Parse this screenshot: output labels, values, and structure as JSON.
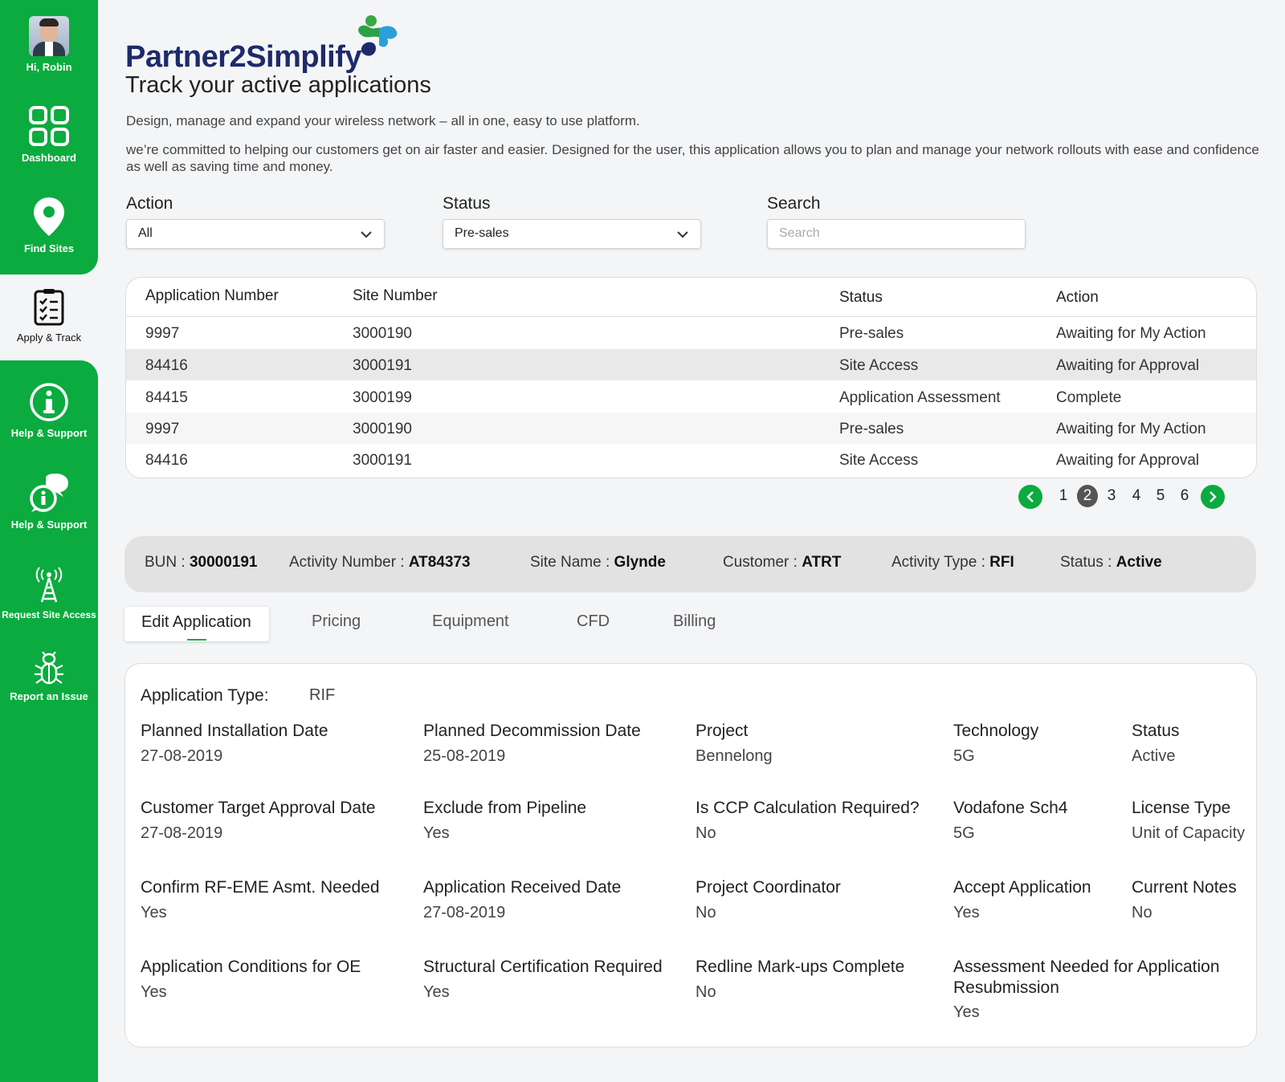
{
  "sidebar": {
    "user_greeting": "Hi, Robin",
    "items": [
      {
        "label": "Dashboard",
        "icon": "grid-icon"
      },
      {
        "label": "Find Sites",
        "icon": "map-pin-icon"
      },
      {
        "label": "Apply & Track",
        "icon": "checklist-icon"
      },
      {
        "label": "Help & Support",
        "icon": "info-icon"
      },
      {
        "label": "Help & Support",
        "icon": "chat-info-icon"
      },
      {
        "label": "Request Site Access",
        "icon": "antenna-tower-icon"
      },
      {
        "label": "Report an Issue",
        "icon": "bug-icon"
      }
    ],
    "active_index": 2
  },
  "header": {
    "logo_text": "Partner2Simplify",
    "title": "Track your active applications",
    "desc1": "Design, manage and expand your wireless network – all in one, easy to use platform.",
    "desc2": "we’re committed to helping our customers get on air faster and easier. Designed for the user, this application allows you to plan and manage  your network rollouts with ease and confidence as well as saving time and money."
  },
  "filters": {
    "action": {
      "label": "Action",
      "value": "All"
    },
    "status": {
      "label": "Status",
      "value": "Pre-sales"
    },
    "search": {
      "label": "Search",
      "placeholder": "Search"
    }
  },
  "table": {
    "columns": [
      "Application Number",
      "Site Number",
      "Status",
      "Action"
    ],
    "rows": [
      [
        "9997",
        "3000190",
        "Pre-sales",
        "Awaiting for My Action"
      ],
      [
        "84416",
        "3000191",
        "Site Access",
        "Awaiting for Approval"
      ],
      [
        "84415",
        "3000199",
        "Application Assessment",
        "Complete"
      ],
      [
        "9997",
        "3000190",
        "Pre-sales",
        "Awaiting for My Action"
      ],
      [
        "84416",
        "3000191",
        "Site Access",
        "Awaiting for Approval"
      ]
    ]
  },
  "pagination": {
    "pages": [
      "1",
      "2",
      "3",
      "4",
      "5",
      "6"
    ],
    "current": "2"
  },
  "info_bar": {
    "bun_label": "BUN :",
    "bun_value": "30000191",
    "activity_label": "Activity Number :",
    "activity_value": "AT84373",
    "site_label": "Site Name :",
    "site_value": "Glynde",
    "customer_label": "Customer :",
    "customer_value": "ATRT",
    "type_label": "Activity Type :",
    "type_value": "RFI",
    "status_label": "Status :",
    "status_value": "Active"
  },
  "tabs": [
    "Edit Application",
    "Pricing",
    "Equipment",
    "CFD",
    "Billing"
  ],
  "details": {
    "app_type_label": "Application Type:",
    "app_type_value": "RIF",
    "fields": [
      {
        "label": "Planned Installation Date",
        "value": "27-08-2019"
      },
      {
        "label": "Planned Decommission Date",
        "value": "25-08-2019"
      },
      {
        "label": "Project",
        "value": "Bennelong"
      },
      {
        "label": "Technology",
        "value": "5G"
      },
      {
        "label": "Status",
        "value": "Active"
      },
      {
        "label": "Customer Target Approval Date",
        "value": "27-08-2019"
      },
      {
        "label": "Exclude from Pipeline",
        "value": "Yes"
      },
      {
        "label": "Is CCP Calculation Required?",
        "value": "No"
      },
      {
        "label": "Vodafone Sch4",
        "value": "5G"
      },
      {
        "label": "License Type",
        "value": "Unit of Capacity"
      },
      {
        "label": "Confirm RF-EME Asmt. Needed",
        "value": "Yes"
      },
      {
        "label": "Application Received Date",
        "value": "27-08-2019"
      },
      {
        "label": "Project Coordinator",
        "value": "No"
      },
      {
        "label": "Accept Application",
        "value": "Yes"
      },
      {
        "label": "Current Notes",
        "value": "No"
      },
      {
        "label": "Application Conditions for OE",
        "value": "Yes"
      },
      {
        "label": "Structural Certification Required",
        "value": "Yes"
      },
      {
        "label": "Redline Mark-ups Complete",
        "value": "No"
      },
      {
        "label": "Assessment Needed for Application Resubmission",
        "value": "Yes"
      }
    ]
  },
  "colors": {
    "brand_green": "#0bab3f",
    "logo_navy": "#1d2b6b",
    "info_bar_bg": "#e2e2e2"
  }
}
